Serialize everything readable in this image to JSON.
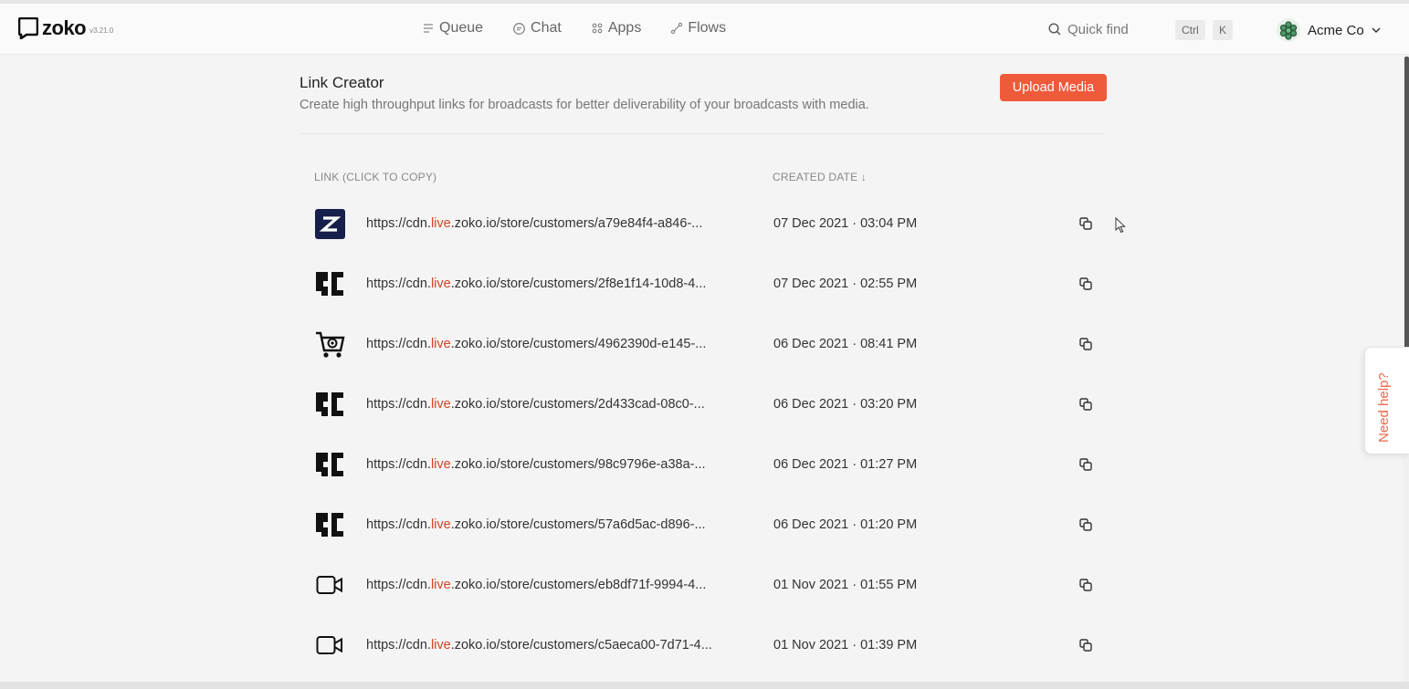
{
  "app": {
    "logo_text": "zoko",
    "version": "v3.21.0"
  },
  "nav": [
    {
      "label": "Queue",
      "icon": "queue-icon"
    },
    {
      "label": "Chat",
      "icon": "chat-icon"
    },
    {
      "label": "Apps",
      "icon": "apps-icon"
    },
    {
      "label": "Flows",
      "icon": "flows-icon"
    }
  ],
  "search": {
    "placeholder": "Quick find",
    "shortcut_mod": "Ctrl",
    "shortcut_key": "K"
  },
  "account": {
    "name": "Acme Co"
  },
  "page": {
    "title": "Link Creator",
    "subtitle": "Create high throughput links for broadcasts for better deliverability of your broadcasts with media.",
    "upload_label": "Upload Media"
  },
  "table": {
    "columns": {
      "link": "LINK (CLICK TO COPY)",
      "date": "CREATED DATE ↓"
    },
    "rows": [
      {
        "thumb": "zoko-logo-thumb",
        "link_pre": "https://cdn.",
        "link_red": "live",
        "link_post": ".zoko.io/store/customers/a79e84f4-a846-...",
        "date": "07 Dec 2021 · 03:04 PM"
      },
      {
        "thumb": "brand-logo-thumb",
        "link_pre": "https://cdn.",
        "link_red": "live",
        "link_post": ".zoko.io/store/customers/2f8e1f14-10d8-4...",
        "date": "07 Dec 2021 · 02:55 PM"
      },
      {
        "thumb": "cart-thumb",
        "link_pre": "https://cdn.",
        "link_red": "live",
        "link_post": ".zoko.io/store/customers/4962390d-e145-...",
        "date": "06 Dec 2021 · 08:41 PM"
      },
      {
        "thumb": "brand-logo-thumb",
        "link_pre": "https://cdn.",
        "link_red": "live",
        "link_post": ".zoko.io/store/customers/2d433cad-08c0-...",
        "date": "06 Dec 2021 · 03:20 PM"
      },
      {
        "thumb": "brand-logo-thumb",
        "link_pre": "https://cdn.",
        "link_red": "live",
        "link_post": ".zoko.io/store/customers/98c9796e-a38a-...",
        "date": "06 Dec 2021 · 01:27 PM"
      },
      {
        "thumb": "brand-logo-thumb",
        "link_pre": "https://cdn.",
        "link_red": "live",
        "link_post": ".zoko.io/store/customers/57a6d5ac-d896-...",
        "date": "06 Dec 2021 · 01:20 PM"
      },
      {
        "thumb": "video-thumb",
        "link_pre": "https://cdn.",
        "link_red": "live",
        "link_post": ".zoko.io/store/customers/eb8df71f-9994-4...",
        "date": "01 Nov 2021 · 01:55 PM"
      },
      {
        "thumb": "video-thumb",
        "link_pre": "https://cdn.",
        "link_red": "live",
        "link_post": ".zoko.io/store/customers/c5aeca00-7d71-4...",
        "date": "01 Nov 2021 · 01:39 PM"
      }
    ]
  },
  "help": {
    "label": "Need help?"
  },
  "colors": {
    "accent": "#ef5a3a",
    "link_highlight": "#d0452a"
  }
}
